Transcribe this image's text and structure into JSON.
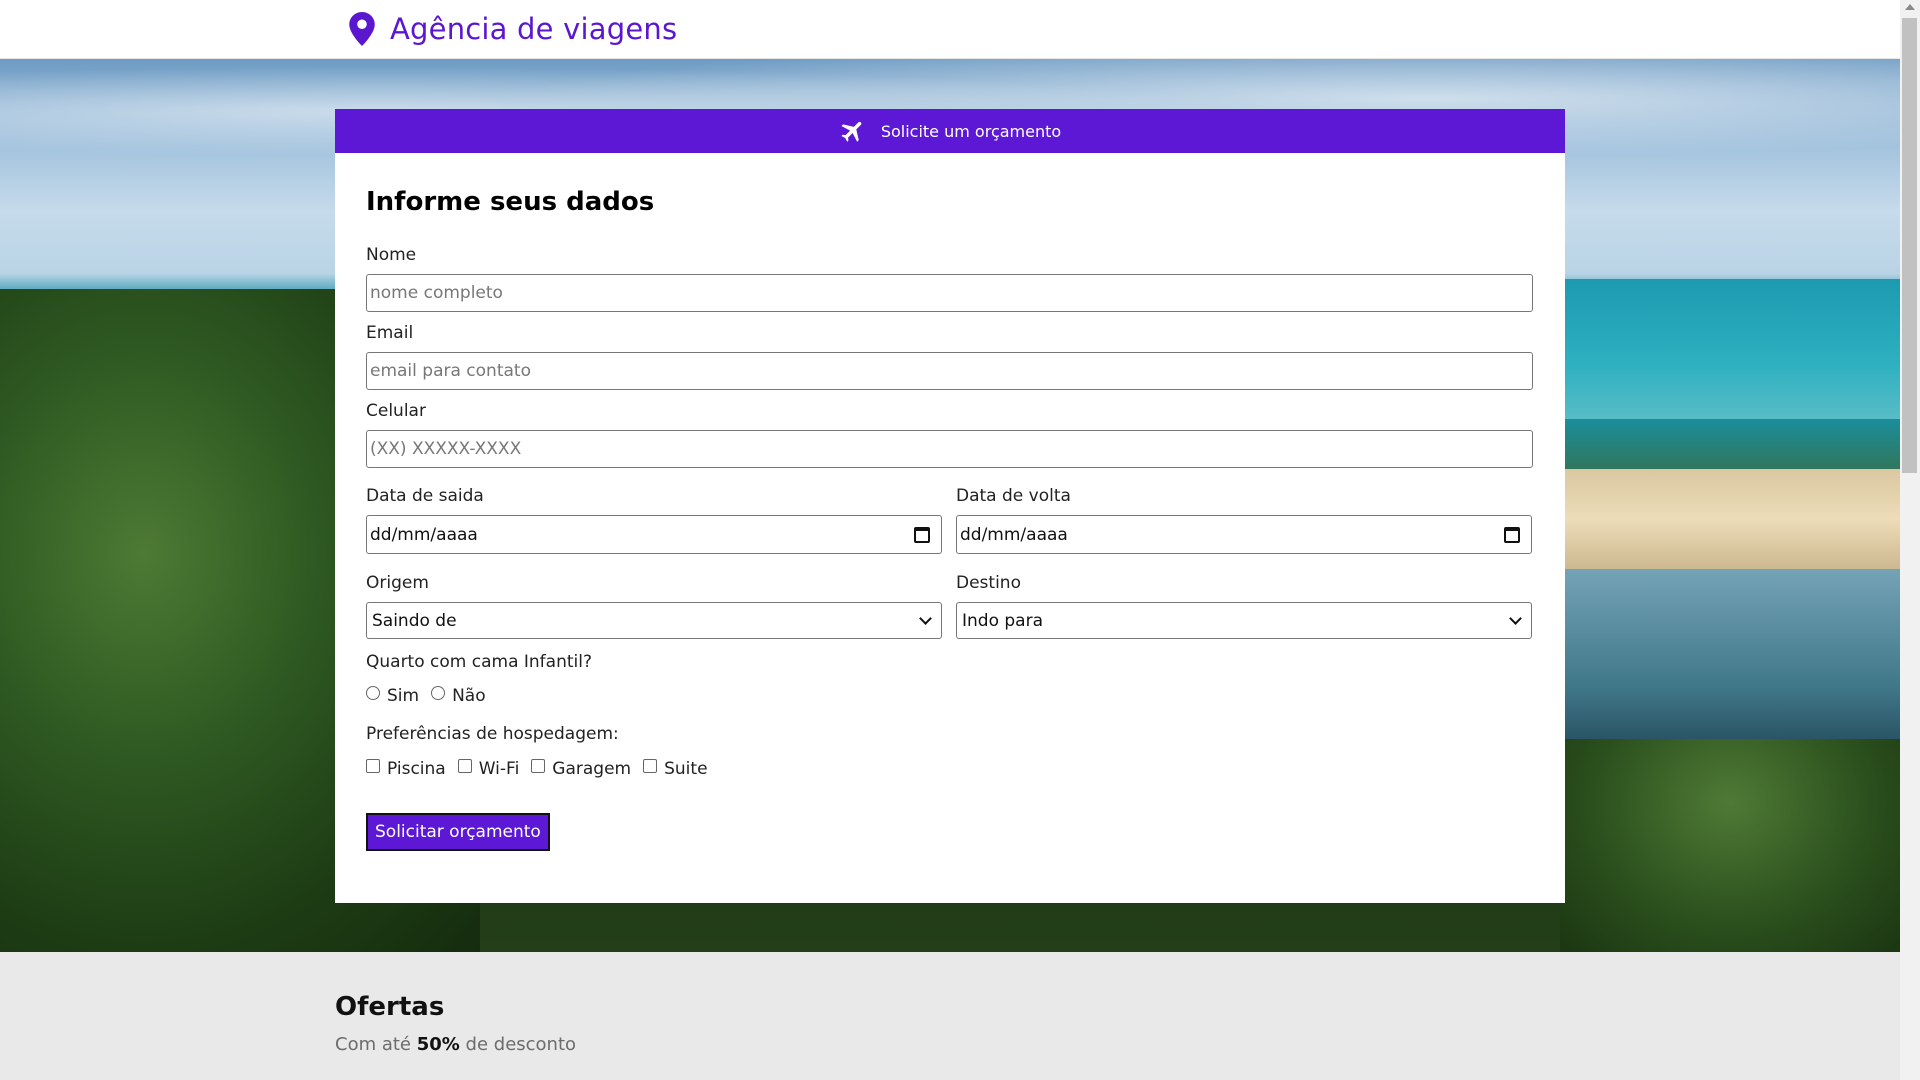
{
  "header": {
    "title": "Agência de viagens",
    "icon": "map-pin-icon",
    "brand_color": "#5a17cf"
  },
  "card": {
    "header_text": "Solicite um orçamento",
    "header_icon": "airplane-icon",
    "header_color": "#5c18d4",
    "form_title": "Informe seus dados",
    "fields": {
      "nome": {
        "label": "Nome",
        "placeholder": "nome completo"
      },
      "email": {
        "label": "Email",
        "placeholder": "email para contato"
      },
      "celular": {
        "label": "Celular",
        "placeholder": "(XX) XXXXX-XXXX"
      },
      "data_saida": {
        "label": "Data de saida",
        "value": "dd/mm/aaaa"
      },
      "data_volta": {
        "label": "Data de volta",
        "value": "dd/mm/aaaa"
      },
      "origem": {
        "label": "Origem",
        "selected": "Saindo de"
      },
      "destino": {
        "label": "Destino",
        "selected": "Indo para"
      }
    },
    "quarto": {
      "label": "Quarto com cama Infantil?",
      "options": [
        "Sim",
        "Não"
      ]
    },
    "preferencias": {
      "label": "Preferências de hospedagem:",
      "options": [
        "Piscina",
        "Wi-Fi",
        "Garagem",
        "Suite"
      ]
    },
    "submit_label": "Solicitar orçamento"
  },
  "offers": {
    "title": "Ofertas",
    "subtitle_prefix": "Com até ",
    "subtitle_bold": "50%",
    "subtitle_suffix": " de desconto"
  }
}
